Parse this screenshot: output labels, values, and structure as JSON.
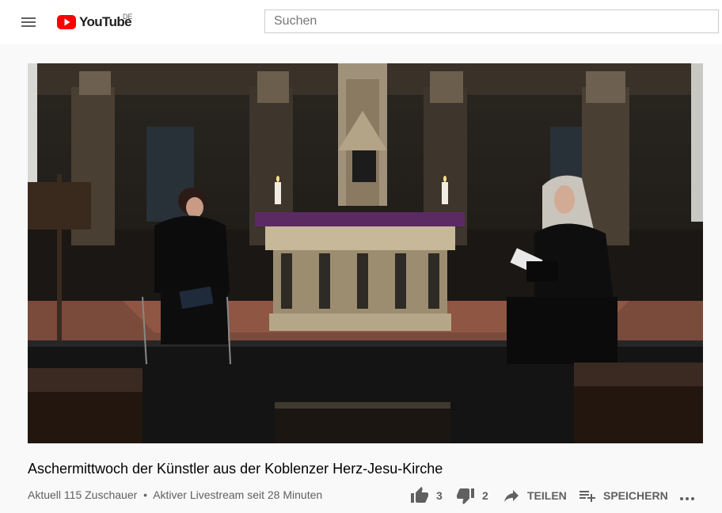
{
  "header": {
    "logo_text": "YouTube",
    "country_code": "DE",
    "search_placeholder": "Suchen",
    "brand_color": "#ff0000"
  },
  "video": {
    "title": "Aschermittwoch der Künstler aus der Koblenzer Herz-Jesu-Kirche",
    "viewers": "Aktuell 115 Zuschauer",
    "separator": "•",
    "live_status": "Aktiver Livestream seit 28 Minuten"
  },
  "actions": {
    "like_count": "3",
    "dislike_count": "2",
    "share_label": "TEILEN",
    "save_label": "SPEICHERN",
    "more_icon": "more-horizontal-icon"
  }
}
